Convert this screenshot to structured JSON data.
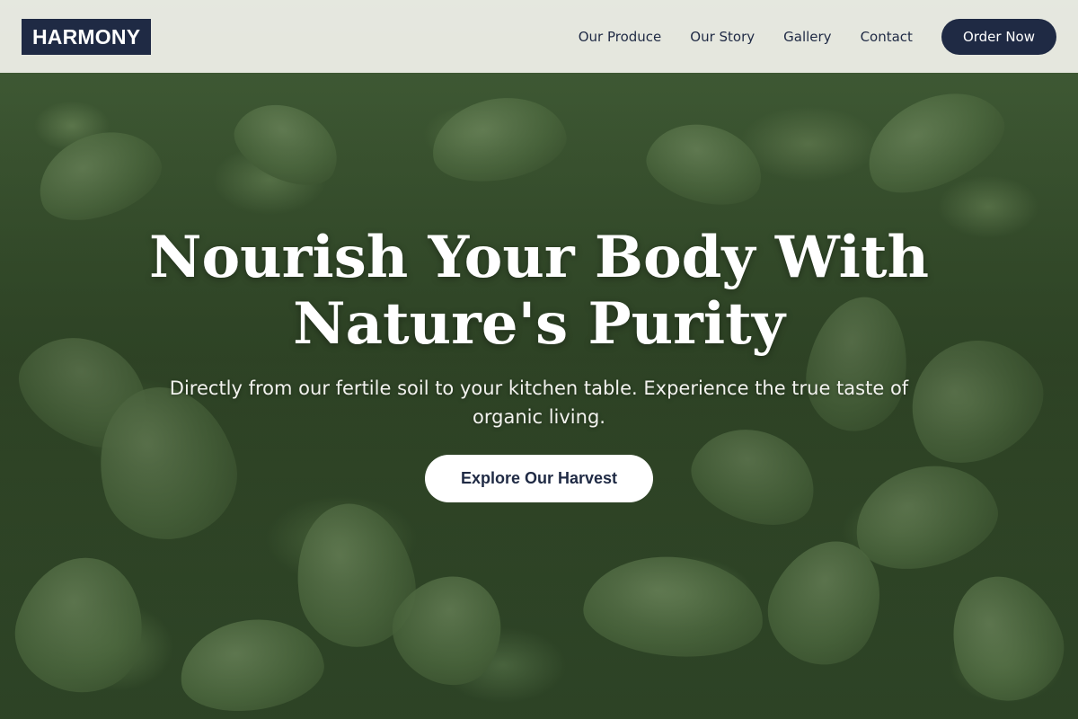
{
  "brand": {
    "logo_text": "HARMONY"
  },
  "nav": {
    "links": [
      {
        "label": "Our Produce"
      },
      {
        "label": "Our Story"
      },
      {
        "label": "Gallery"
      },
      {
        "label": "Contact"
      }
    ],
    "cta_label": "Order Now"
  },
  "hero": {
    "title": "Nourish Your Body With Nature's Purity",
    "subtitle": "Directly from our fertile soil to your kitchen table. Experience the true taste of organic living.",
    "button_label": "Explore Our Harvest"
  },
  "colors": {
    "brand_navy": "#1f2a44",
    "header_bg": "#f2f2ec",
    "hero_green": "#4b6a3f",
    "white": "#ffffff"
  }
}
